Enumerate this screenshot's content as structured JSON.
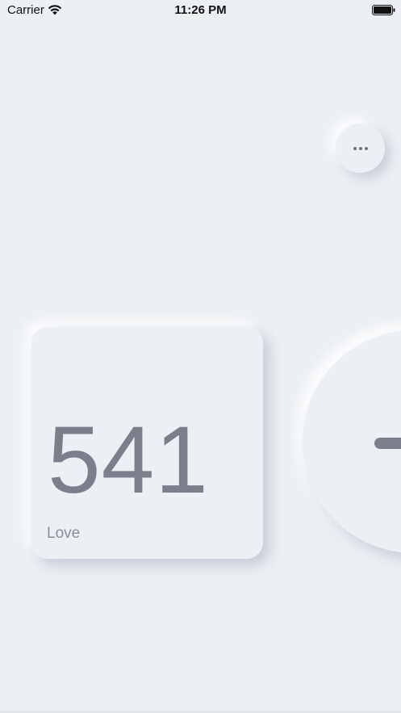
{
  "status_bar": {
    "carrier": "Carrier",
    "time": "11:26 PM",
    "wifi_icon": "wifi-icon",
    "battery_icon": "battery-full-icon"
  },
  "toolbar": {
    "more_icon": "ellipsis-icon"
  },
  "counter": {
    "value": "541",
    "label": "Love"
  },
  "controls": {
    "decrement_icon": "minus-icon"
  },
  "colors": {
    "background": "#ECEFF3",
    "accent_text": "#7C7F8B",
    "label_text": "#8A8E98"
  }
}
